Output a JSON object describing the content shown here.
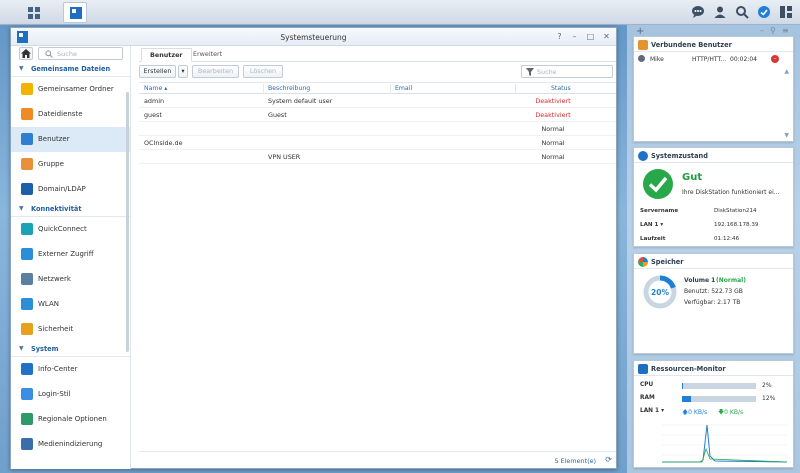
{
  "window": {
    "title": "Systemsteuerung",
    "controls": [
      "?",
      "–",
      "□",
      "✕"
    ]
  },
  "sidebar": {
    "search_placeholder": "Suche",
    "sections": [
      {
        "label": "Gemeinsame Dateien",
        "items": [
          {
            "label": "Gemeinsamer Ordner",
            "icon": "folder-icon",
            "color": "#f3b400"
          },
          {
            "label": "Dateidienste",
            "icon": "file-services-icon",
            "color": "#f08a24"
          },
          {
            "label": "Benutzer",
            "icon": "user-icon",
            "color": "#2e7fcf",
            "selected": true
          },
          {
            "label": "Gruppe",
            "icon": "group-icon",
            "color": "#e8913a"
          },
          {
            "label": "Domain/LDAP",
            "icon": "domain-icon",
            "color": "#1d5fa8"
          }
        ]
      },
      {
        "label": "Konnektivität",
        "items": [
          {
            "label": "QuickConnect",
            "icon": "quickconnect-icon",
            "color": "#1aa3b5"
          },
          {
            "label": "Externer Zugriff",
            "icon": "globe-icon",
            "color": "#2b8ed8"
          },
          {
            "label": "Netzwerk",
            "icon": "network-icon",
            "color": "#5b7fa3"
          },
          {
            "label": "WLAN",
            "icon": "wifi-icon",
            "color": "#2b8ed8"
          },
          {
            "label": "Sicherheit",
            "icon": "shield-icon",
            "color": "#e6a21d"
          }
        ]
      },
      {
        "label": "System",
        "items": [
          {
            "label": "Info-Center",
            "icon": "info-icon",
            "color": "#1f72c6"
          },
          {
            "label": "Login-Stil",
            "icon": "login-style-icon",
            "color": "#3a8de0"
          },
          {
            "label": "Regionale Optionen",
            "icon": "regional-icon",
            "color": "#2e9a6a"
          },
          {
            "label": "Medienindizierung",
            "icon": "media-index-icon",
            "color": "#3a6ea8"
          }
        ]
      }
    ]
  },
  "tabs": [
    "Benutzer",
    "Erweitert"
  ],
  "toolbar": {
    "create": "Erstellen",
    "edit": "Bearbeiten",
    "delete": "Löschen",
    "filter_placeholder": "Suche"
  },
  "table": {
    "headers": [
      "Name ▴",
      "Beschreibung",
      "Email",
      "Status"
    ],
    "rows": [
      {
        "name": "admin",
        "desc": "System default user",
        "email": "",
        "status": "Deaktiviert",
        "disabled": true
      },
      {
        "name": "guest",
        "desc": "Guest",
        "email": "",
        "status": "Deaktiviert",
        "disabled": true
      },
      {
        "name": "",
        "desc": "",
        "email": "",
        "status": "Normal",
        "disabled": false
      },
      {
        "name": "OCInside.de",
        "desc": "",
        "email": "",
        "status": "Normal",
        "disabled": false
      },
      {
        "name": "",
        "desc": "VPN USER",
        "email": "",
        "status": "Normal",
        "disabled": false
      }
    ],
    "count": "5 Element(e)"
  },
  "widgets": {
    "users": {
      "title": "Verbundene Benutzer",
      "rows": [
        {
          "name": "Mike",
          "proto": "HTTP/HTT...",
          "time": "00:02:04"
        }
      ]
    },
    "health": {
      "title": "Systemzustand",
      "status": "Gut",
      "message": "Ihre DiskStation funktioniert ei...",
      "fields": [
        {
          "k": "Servername",
          "v": "DiskStation214"
        },
        {
          "k": "LAN 1 ▾",
          "v": "192.168.178.39"
        },
        {
          "k": "Laufzeit",
          "v": "01:12:46"
        }
      ]
    },
    "storage": {
      "title": "Speicher",
      "percent": "20%",
      "volume": "Volume 1",
      "volume_state": "(Normal)",
      "used": "Benutzt: 522.73 GB",
      "free": "Verfügbar: 2.17 TB"
    },
    "resource": {
      "title": "Ressourcen-Monitor",
      "cpu_label": "CPU",
      "cpu_value": "2%",
      "cpu_fraction": 0.02,
      "ram_label": "RAM",
      "ram_value": "12%",
      "ram_fraction": 0.12,
      "lan_label": "LAN 1 ▾",
      "up": "0 KB/s",
      "down": "0 KB/s"
    }
  }
}
